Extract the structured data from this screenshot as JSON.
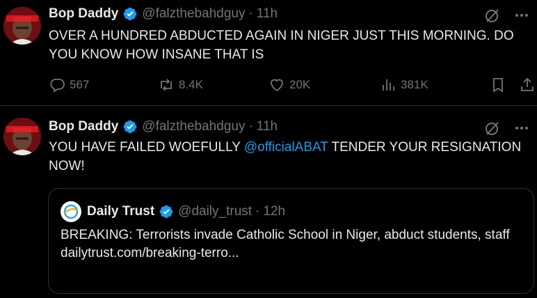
{
  "tweets": [
    {
      "author_name": "Bop Daddy",
      "handle": "@falzthebahdguy",
      "separator": "·",
      "time": "11h",
      "text": "OVER A HUNDRED ABDUCTED AGAIN IN NIGER JUST THIS MORNING. DO YOU KNOW HOW INSANE THAT IS",
      "stats": {
        "replies": "567",
        "reposts": "8.4K",
        "likes": "20K",
        "views": "381K"
      }
    },
    {
      "author_name": "Bop Daddy",
      "handle": "@falzthebahdguy",
      "separator": "·",
      "time": "11h",
      "text_before": "YOU HAVE FAILED WOEFULLY ",
      "mention": "@officialABAT",
      "text_after": " TENDER YOUR RESIGNATION NOW!",
      "quote": {
        "author_name": "Daily Trust",
        "handle": "@daily_trust",
        "separator": "·",
        "time": "12h",
        "text_line1": "BREAKING: Terrorists invade Catholic School in Niger, abduct students, staff",
        "link": "dailytrust.com/breaking-terro..."
      }
    }
  ],
  "colors": {
    "background": "#000000",
    "text": "#e7e9ea",
    "muted": "#71767b",
    "accent": "#1d9bf0",
    "border": "#2f3336"
  },
  "icons": [
    "verified-badge-icon",
    "grok-icon",
    "more-icon",
    "reply-icon",
    "repost-icon",
    "like-icon",
    "views-icon",
    "bookmark-icon",
    "share-icon"
  ]
}
